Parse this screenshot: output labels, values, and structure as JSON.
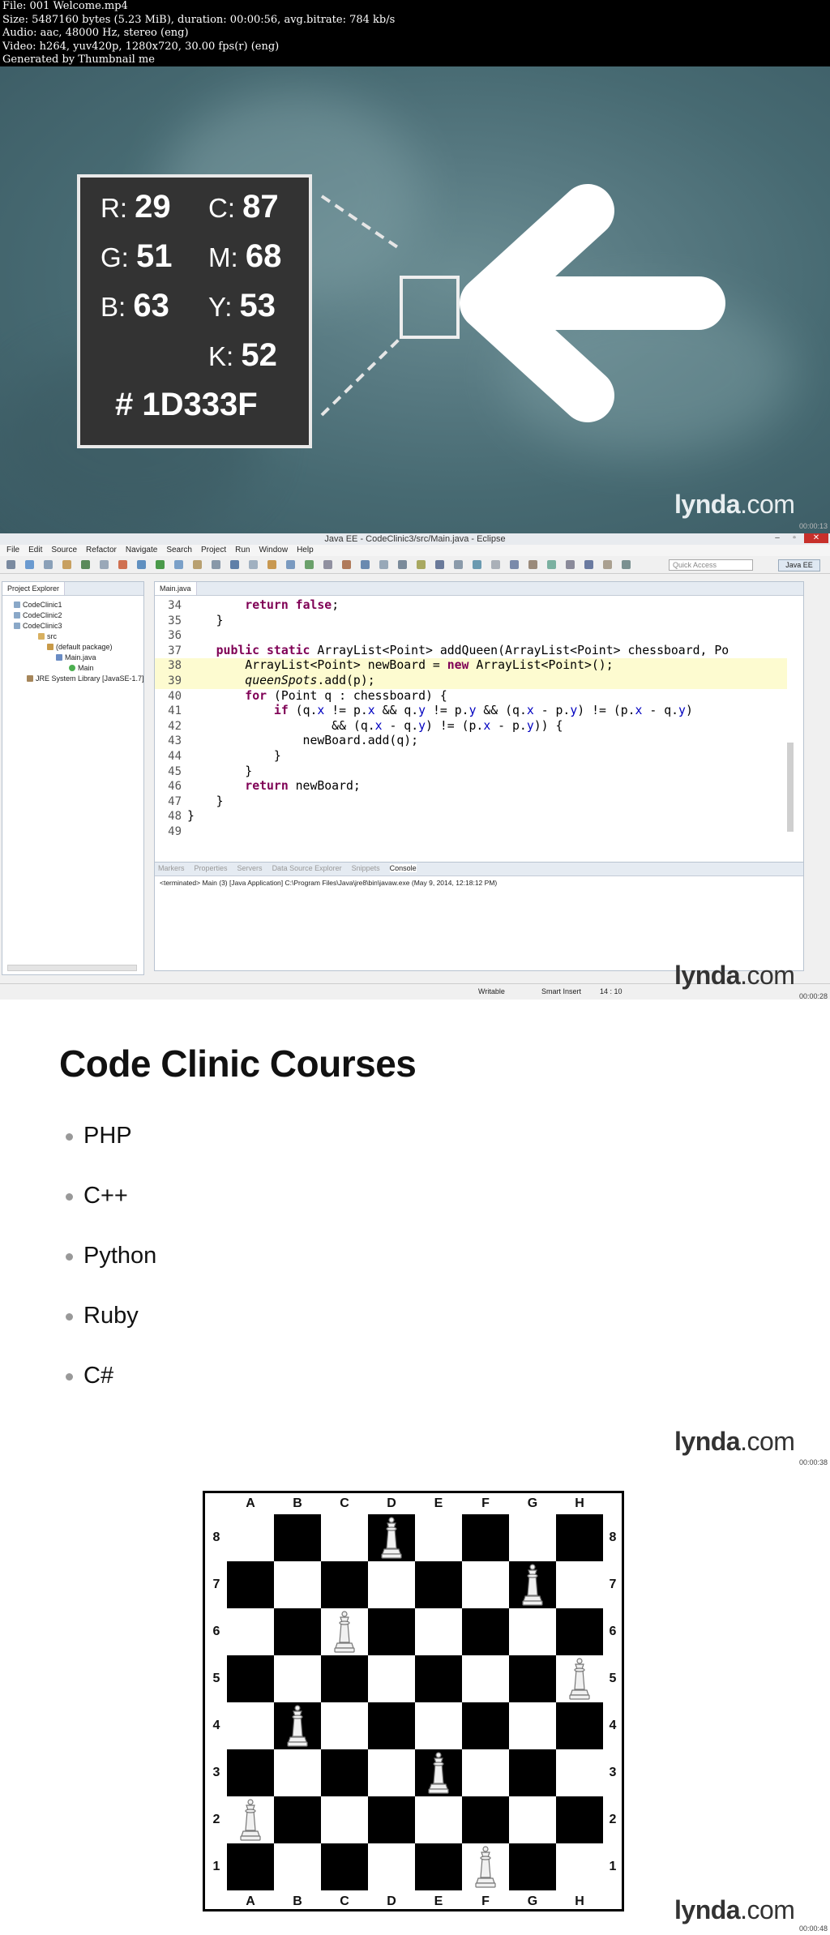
{
  "header": {
    "lines": [
      "File: 001 Welcome.mp4",
      "Size: 5487160 bytes (5.23 MiB), duration: 00:00:56, avg.bitrate: 784 kb/s",
      "Audio: aac, 48000 Hz, stereo (eng)",
      "Video: h264, yuv420p, 1280x720, 30.00 fps(r) (eng)",
      "Generated by Thumbnail me"
    ]
  },
  "watermark": {
    "brand": "lynda",
    "suffix": ".com"
  },
  "frame1": {
    "timestamp": "00:00:13",
    "color_values": {
      "r_label": "R:",
      "r_value": "29",
      "g_label": "G:",
      "g_value": "51",
      "b_label": "B:",
      "b_value": "63",
      "c_label": "C:",
      "c_value": "87",
      "m_label": "M:",
      "m_value": "68",
      "y_label": "Y:",
      "y_value": "53",
      "k_label": "K:",
      "k_value": "52",
      "hex": "# 1D333F"
    },
    "swatch_color": "#1D333F"
  },
  "frame2": {
    "timestamp": "00:00:28",
    "window_title": "Java EE - CodeClinic3/src/Main.java - Eclipse",
    "menu": [
      "File",
      "Edit",
      "Source",
      "Refactor",
      "Navigate",
      "Search",
      "Project",
      "Run",
      "Window",
      "Help"
    ],
    "quick_access": "Quick Access",
    "perspective": "Java EE",
    "project_explorer": {
      "tab": "Project Explorer",
      "items": [
        "CodeClinic1",
        "CodeClinic2",
        "CodeClinic3",
        "src",
        "(default package)",
        "Main.java",
        "Main",
        "JRE System Library [JavaSE-1.7]"
      ]
    },
    "editor": {
      "tab": "Main.java",
      "lines": [
        {
          "n": "34",
          "t": "        return false;"
        },
        {
          "n": "35",
          "t": "    }"
        },
        {
          "n": "36",
          "t": ""
        },
        {
          "n": "37",
          "t": "    public static ArrayList<Point> addQueen(ArrayList<Point> chessboard, Po"
        },
        {
          "n": "38",
          "t": "        ArrayList<Point> newBoard = new ArrayList<Point>();"
        },
        {
          "n": "39",
          "t": "        queenSpots.add(p);"
        },
        {
          "n": "40",
          "t": "        for (Point q : chessboard) {"
        },
        {
          "n": "41",
          "t": "            if (q.x != p.x && q.y != p.y && (q.x - p.y) != (p.x - q.y)"
        },
        {
          "n": "42",
          "t": "                    && (q.x - q.y) != (p.x - p.y)) {"
        },
        {
          "n": "43",
          "t": "                newBoard.add(q);"
        },
        {
          "n": "44",
          "t": "            }"
        },
        {
          "n": "45",
          "t": "        }"
        },
        {
          "n": "46",
          "t": "        return newBoard;"
        },
        {
          "n": "47",
          "t": "    }"
        },
        {
          "n": "48",
          "t": "}"
        },
        {
          "n": "49",
          "t": ""
        }
      ]
    },
    "console": {
      "tabs": [
        "Markers",
        "Properties",
        "Servers",
        "Data Source Explorer",
        "Snippets",
        "Console"
      ],
      "output": "<terminated> Main (3) [Java Application] C:\\Program Files\\Java\\jre8\\bin\\javaw.exe (May 9, 2014, 12:18:12 PM)"
    },
    "status": {
      "writable": "Writable",
      "insert": "Smart Insert",
      "position": "14 : 10"
    }
  },
  "frame3": {
    "timestamp": "00:00:38",
    "title": "Code Clinic Courses",
    "courses": [
      "PHP",
      "C++",
      "Python",
      "Ruby",
      "C#"
    ]
  },
  "frame4": {
    "timestamp": "00:00:48",
    "files": [
      "A",
      "B",
      "C",
      "D",
      "E",
      "F",
      "G",
      "H"
    ],
    "ranks": [
      "8",
      "7",
      "6",
      "5",
      "4",
      "3",
      "2",
      "1"
    ],
    "queens": [
      {
        "file": "D",
        "rank": "8"
      },
      {
        "file": "G",
        "rank": "7"
      },
      {
        "file": "C",
        "rank": "6"
      },
      {
        "file": "H",
        "rank": "5"
      },
      {
        "file": "B",
        "rank": "4"
      },
      {
        "file": "E",
        "rank": "3"
      },
      {
        "file": "A",
        "rank": "2"
      },
      {
        "file": "F",
        "rank": "1"
      }
    ]
  }
}
